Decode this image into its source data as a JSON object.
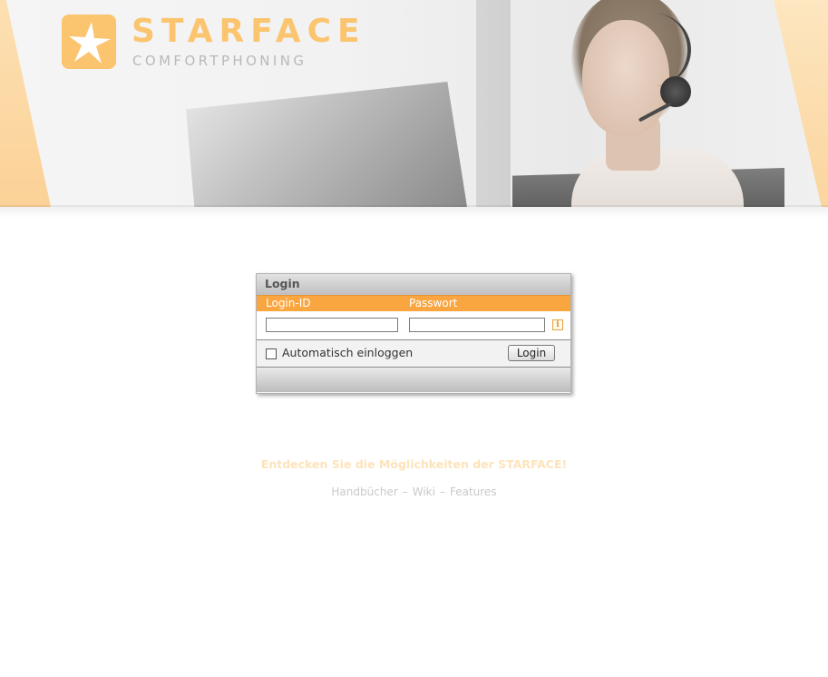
{
  "brand": {
    "name": "STARFACE",
    "tagline": "COMFORTPHONING",
    "color": "#fbc46f"
  },
  "login": {
    "title": "Login",
    "login_id_label": "Login-ID",
    "password_label": "Passwort",
    "login_id_value": "",
    "password_value": "",
    "info_icon": "i",
    "auto_login_label": "Automatisch einloggen",
    "auto_login_checked": false,
    "submit_label": "Login",
    "accent_color": "#f9a641"
  },
  "footer": {
    "discover_text": "Entdecken Sie die Möglichkeiten der STARFACE!",
    "links": [
      "Handbücher",
      "Wiki",
      "Features"
    ],
    "separator": "–"
  }
}
